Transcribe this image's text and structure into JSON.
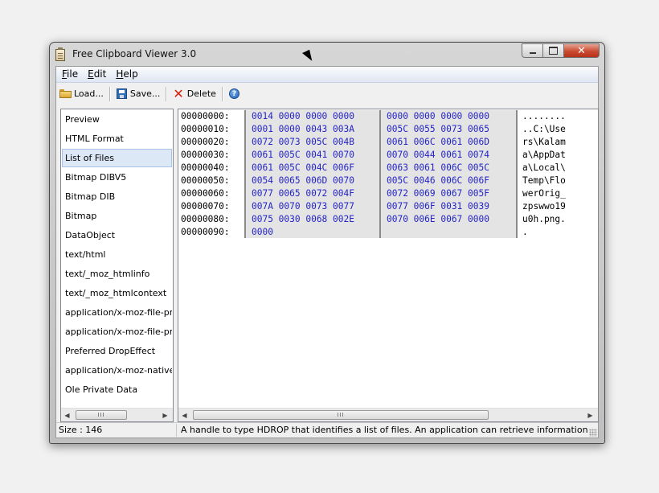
{
  "window": {
    "title": "Free Clipboard Viewer 3.0"
  },
  "menu": [
    {
      "label": "File",
      "accel": "F",
      "rest": "ile"
    },
    {
      "label": "Edit",
      "accel": "E",
      "rest": "dit"
    },
    {
      "label": "Help",
      "accel": "H",
      "rest": "elp"
    }
  ],
  "toolbar": {
    "load_label": "Load...",
    "save_label": "Save...",
    "delete_label": "Delete",
    "help_icon": "?"
  },
  "formats": [
    "Preview",
    "HTML Format",
    "List of Files",
    "Bitmap DIBV5",
    "Bitmap DIB",
    "Bitmap",
    "DataObject",
    "text/html",
    "text/_moz_htmlinfo",
    "text/_moz_htmlcontext",
    "application/x-moz-file-promise",
    "application/x-moz-file-promise",
    "Preferred DropEffect",
    "application/x-moz-nativeimage",
    "Ole Private Data"
  ],
  "selected_format": "List of Files",
  "hex": {
    "rows": [
      {
        "addr": "00000000:",
        "g1": "0014 0000 0000 0000",
        "g2": "0000 0000 0000 0000",
        "ascii": "........"
      },
      {
        "addr": "00000010:",
        "g1": "0001 0000 0043 003A",
        "g2": "005C 0055 0073 0065",
        "ascii": "..C:\\Use"
      },
      {
        "addr": "00000020:",
        "g1": "0072 0073 005C 004B",
        "g2": "0061 006C 0061 006D",
        "ascii": "rs\\Kalam"
      },
      {
        "addr": "00000030:",
        "g1": "0061 005C 0041 0070",
        "g2": "0070 0044 0061 0074",
        "ascii": "a\\AppDat"
      },
      {
        "addr": "00000040:",
        "g1": "0061 005C 004C 006F",
        "g2": "0063 0061 006C 005C",
        "ascii": "a\\Local\\"
      },
      {
        "addr": "00000050:",
        "g1": "0054 0065 006D 0070",
        "g2": "005C 0046 006C 006F",
        "ascii": "Temp\\Flo"
      },
      {
        "addr": "00000060:",
        "g1": "0077 0065 0072 004F",
        "g2": "0072 0069 0067 005F",
        "ascii": "werOrig_"
      },
      {
        "addr": "00000070:",
        "g1": "007A 0070 0073 0077",
        "g2": "0077 006F 0031 0039",
        "ascii": "zpswwo19"
      },
      {
        "addr": "00000080:",
        "g1": "0075 0030 0068 002E",
        "g2": "0070 006E 0067 0000",
        "ascii": "u0h.png."
      },
      {
        "addr": "00000090:",
        "g1": "0000",
        "g2": "",
        "ascii": "."
      }
    ]
  },
  "scrollbar": {
    "thumb_label": "III",
    "left_arrow": "◀",
    "right_arrow": "▶"
  },
  "status": {
    "size": "Size : 146",
    "description": "A handle to type HDROP that identifies a list of files. An application can retrieve information about the files by passing the handle to the DragQueryFile function."
  },
  "colors": {
    "hex_text": "#2424c8",
    "selection": "#dde8f7",
    "close_button": "#c94a30"
  },
  "icons": {
    "app": "clipboard-icon",
    "load": "folder-open-icon",
    "save": "floppy-disk-icon",
    "delete": "red-x-icon",
    "help": "help-circle-icon"
  }
}
